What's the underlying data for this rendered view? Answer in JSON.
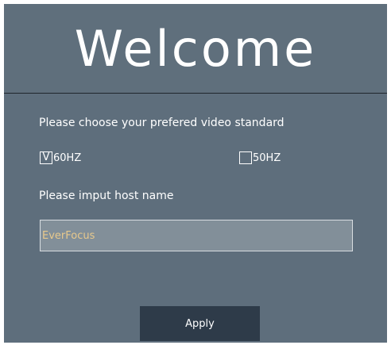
{
  "header": {
    "title": "Welcome"
  },
  "video_standard": {
    "prompt": "Please choose your prefered video standard",
    "options": [
      {
        "label": "60HZ",
        "checked": true,
        "mark": "V"
      },
      {
        "label": "50HZ",
        "checked": false,
        "mark": ""
      }
    ]
  },
  "host": {
    "prompt": "Please imput host name",
    "value": "EverFocus"
  },
  "actions": {
    "apply_label": "Apply"
  },
  "colors": {
    "panel_bg": "#5e6e7c",
    "input_bg": "#828f99",
    "input_text": "#e8c98c",
    "button_bg": "#2e3b49"
  }
}
